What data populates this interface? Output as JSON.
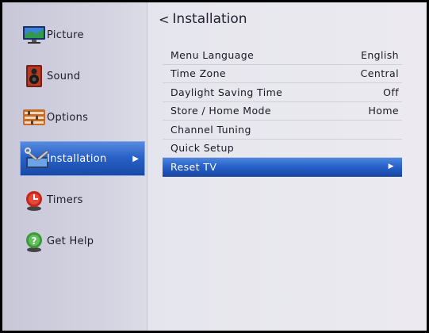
{
  "menu": {
    "title": "Installation",
    "back_symbol": "<"
  },
  "sidebar": {
    "items": [
      {
        "label": "Picture",
        "icon": "picture-icon"
      },
      {
        "label": "Sound",
        "icon": "sound-icon"
      },
      {
        "label": "Options",
        "icon": "options-icon"
      },
      {
        "label": "Installation",
        "icon": "installation-icon",
        "active": true
      },
      {
        "label": "Timers",
        "icon": "timers-icon"
      },
      {
        "label": "Get Help",
        "icon": "help-icon"
      }
    ],
    "active_arrow": "▶"
  },
  "settings": [
    {
      "label": "Menu Language",
      "value": "English"
    },
    {
      "label": "Time Zone",
      "value": "Central"
    },
    {
      "label": "Daylight Saving Time",
      "value": "Off"
    },
    {
      "label": "Store / Home Mode",
      "value": "Home"
    },
    {
      "label": "Channel Tuning",
      "value": ""
    },
    {
      "label": "Quick Setup",
      "value": ""
    },
    {
      "label": "Reset TV",
      "value": "▶",
      "selected": true
    }
  ],
  "colors": {
    "accent_blue": "#2660c8",
    "background": "#e6e6ee"
  }
}
